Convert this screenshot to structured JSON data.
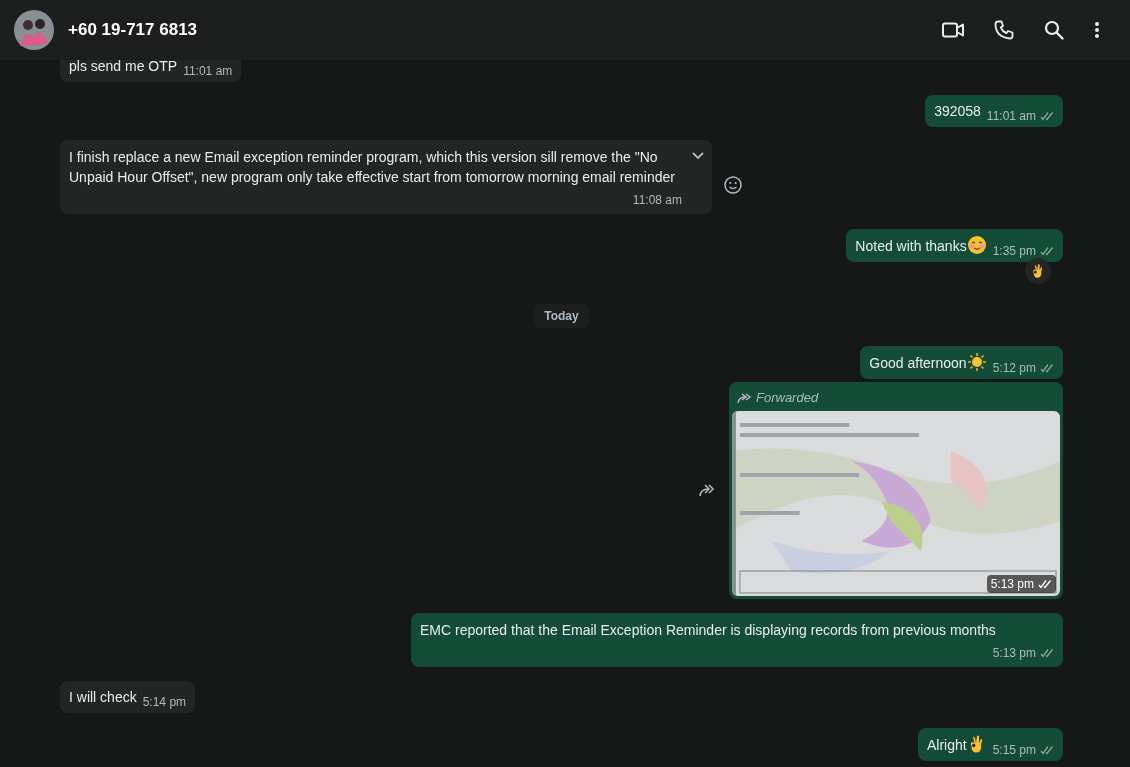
{
  "header": {
    "contact": "+60 19-717 6813"
  },
  "messages": [
    {
      "kind": "text",
      "outgoing": false,
      "text": "pls send me OTP",
      "time": "11:01 am"
    },
    {
      "kind": "text",
      "outgoing": true,
      "text": "392058",
      "time": "11:01 am",
      "delivered": true
    },
    {
      "kind": "text",
      "outgoing": false,
      "text": "I finish replace a new Email exception reminder program, which this version sill remove  the \"No Unpaid Hour Offset\", new program only take effective start from tomorrow morning email reminder",
      "time": "11:08 am",
      "hovered": true
    },
    {
      "kind": "text",
      "outgoing": true,
      "text": "Noted with thanks",
      "emoji": {
        "kind": "smile"
      },
      "time": "1:35 pm",
      "delivered": true,
      "reaction": {
        "kind": "ok"
      }
    },
    {
      "kind": "divider",
      "text": "Today"
    },
    {
      "kind": "text",
      "outgoing": true,
      "text": "Good afternoon",
      "emoji": {
        "kind": "sun"
      },
      "time": "5:12 pm",
      "delivered": true
    },
    {
      "outgoing": true,
      "forwarded": "Forwarded",
      "time": "5:13 pm",
      "delivered": true
    },
    {
      "kind": "text",
      "outgoing": true,
      "text": "EMC reported that the Email Exception Reminder is displaying records from previous months",
      "time": "5:13 pm",
      "delivered": true
    },
    {
      "kind": "text",
      "outgoing": false,
      "text": "I will check",
      "time": "5:14 pm"
    },
    {
      "kind": "text",
      "outgoing": true,
      "text": "Alright",
      "emoji": {
        "kind": "ok"
      },
      "time": "5:15 pm",
      "delivered": true
    }
  ]
}
